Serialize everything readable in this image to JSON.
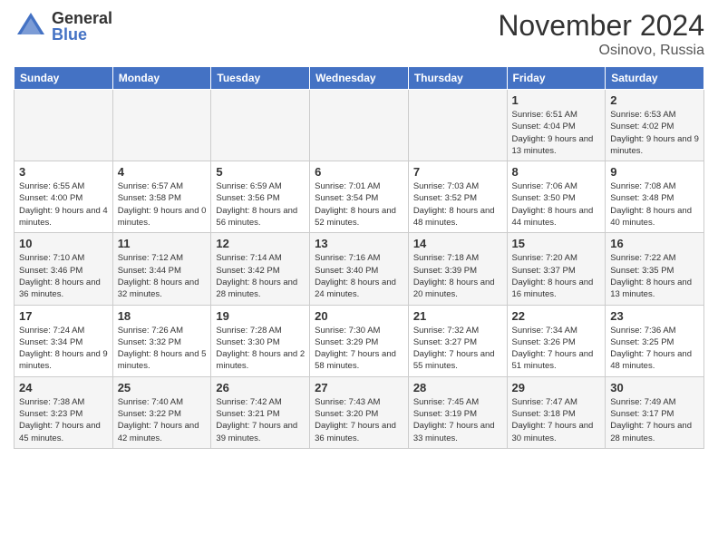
{
  "logo": {
    "general": "General",
    "blue": "Blue"
  },
  "header": {
    "month": "November 2024",
    "location": "Osinovo, Russia"
  },
  "days_of_week": [
    "Sunday",
    "Monday",
    "Tuesday",
    "Wednesday",
    "Thursday",
    "Friday",
    "Saturday"
  ],
  "weeks": [
    [
      {
        "day": "",
        "info": ""
      },
      {
        "day": "",
        "info": ""
      },
      {
        "day": "",
        "info": ""
      },
      {
        "day": "",
        "info": ""
      },
      {
        "day": "",
        "info": ""
      },
      {
        "day": "1",
        "info": "Sunrise: 6:51 AM\nSunset: 4:04 PM\nDaylight: 9 hours and 13 minutes."
      },
      {
        "day": "2",
        "info": "Sunrise: 6:53 AM\nSunset: 4:02 PM\nDaylight: 9 hours and 9 minutes."
      }
    ],
    [
      {
        "day": "3",
        "info": "Sunrise: 6:55 AM\nSunset: 4:00 PM\nDaylight: 9 hours and 4 minutes."
      },
      {
        "day": "4",
        "info": "Sunrise: 6:57 AM\nSunset: 3:58 PM\nDaylight: 9 hours and 0 minutes."
      },
      {
        "day": "5",
        "info": "Sunrise: 6:59 AM\nSunset: 3:56 PM\nDaylight: 8 hours and 56 minutes."
      },
      {
        "day": "6",
        "info": "Sunrise: 7:01 AM\nSunset: 3:54 PM\nDaylight: 8 hours and 52 minutes."
      },
      {
        "day": "7",
        "info": "Sunrise: 7:03 AM\nSunset: 3:52 PM\nDaylight: 8 hours and 48 minutes."
      },
      {
        "day": "8",
        "info": "Sunrise: 7:06 AM\nSunset: 3:50 PM\nDaylight: 8 hours and 44 minutes."
      },
      {
        "day": "9",
        "info": "Sunrise: 7:08 AM\nSunset: 3:48 PM\nDaylight: 8 hours and 40 minutes."
      }
    ],
    [
      {
        "day": "10",
        "info": "Sunrise: 7:10 AM\nSunset: 3:46 PM\nDaylight: 8 hours and 36 minutes."
      },
      {
        "day": "11",
        "info": "Sunrise: 7:12 AM\nSunset: 3:44 PM\nDaylight: 8 hours and 32 minutes."
      },
      {
        "day": "12",
        "info": "Sunrise: 7:14 AM\nSunset: 3:42 PM\nDaylight: 8 hours and 28 minutes."
      },
      {
        "day": "13",
        "info": "Sunrise: 7:16 AM\nSunset: 3:40 PM\nDaylight: 8 hours and 24 minutes."
      },
      {
        "day": "14",
        "info": "Sunrise: 7:18 AM\nSunset: 3:39 PM\nDaylight: 8 hours and 20 minutes."
      },
      {
        "day": "15",
        "info": "Sunrise: 7:20 AM\nSunset: 3:37 PM\nDaylight: 8 hours and 16 minutes."
      },
      {
        "day": "16",
        "info": "Sunrise: 7:22 AM\nSunset: 3:35 PM\nDaylight: 8 hours and 13 minutes."
      }
    ],
    [
      {
        "day": "17",
        "info": "Sunrise: 7:24 AM\nSunset: 3:34 PM\nDaylight: 8 hours and 9 minutes."
      },
      {
        "day": "18",
        "info": "Sunrise: 7:26 AM\nSunset: 3:32 PM\nDaylight: 8 hours and 5 minutes."
      },
      {
        "day": "19",
        "info": "Sunrise: 7:28 AM\nSunset: 3:30 PM\nDaylight: 8 hours and 2 minutes."
      },
      {
        "day": "20",
        "info": "Sunrise: 7:30 AM\nSunset: 3:29 PM\nDaylight: 7 hours and 58 minutes."
      },
      {
        "day": "21",
        "info": "Sunrise: 7:32 AM\nSunset: 3:27 PM\nDaylight: 7 hours and 55 minutes."
      },
      {
        "day": "22",
        "info": "Sunrise: 7:34 AM\nSunset: 3:26 PM\nDaylight: 7 hours and 51 minutes."
      },
      {
        "day": "23",
        "info": "Sunrise: 7:36 AM\nSunset: 3:25 PM\nDaylight: 7 hours and 48 minutes."
      }
    ],
    [
      {
        "day": "24",
        "info": "Sunrise: 7:38 AM\nSunset: 3:23 PM\nDaylight: 7 hours and 45 minutes."
      },
      {
        "day": "25",
        "info": "Sunrise: 7:40 AM\nSunset: 3:22 PM\nDaylight: 7 hours and 42 minutes."
      },
      {
        "day": "26",
        "info": "Sunrise: 7:42 AM\nSunset: 3:21 PM\nDaylight: 7 hours and 39 minutes."
      },
      {
        "day": "27",
        "info": "Sunrise: 7:43 AM\nSunset: 3:20 PM\nDaylight: 7 hours and 36 minutes."
      },
      {
        "day": "28",
        "info": "Sunrise: 7:45 AM\nSunset: 3:19 PM\nDaylight: 7 hours and 33 minutes."
      },
      {
        "day": "29",
        "info": "Sunrise: 7:47 AM\nSunset: 3:18 PM\nDaylight: 7 hours and 30 minutes."
      },
      {
        "day": "30",
        "info": "Sunrise: 7:49 AM\nSunset: 3:17 PM\nDaylight: 7 hours and 28 minutes."
      }
    ]
  ]
}
